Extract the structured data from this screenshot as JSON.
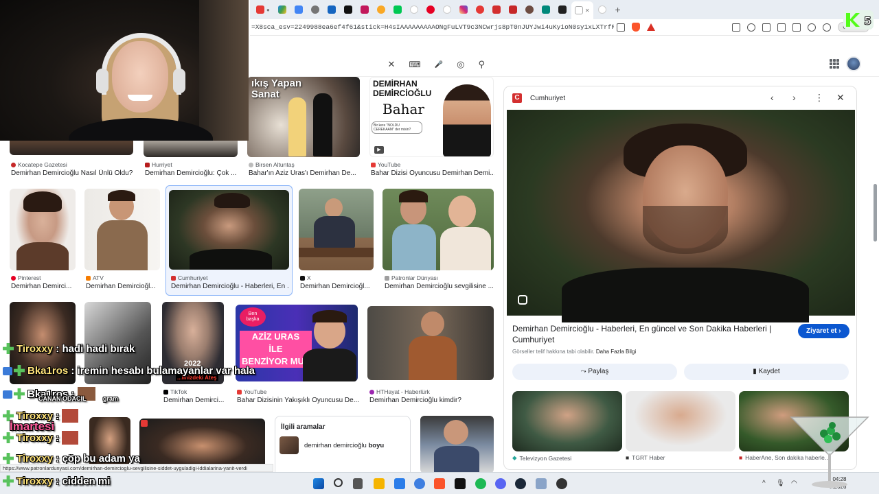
{
  "browser": {
    "url": "=X8sca_esv=2249988ea6ef4f61&stick=H4sIAAAAAAAAAONgFuLVT9c3NCwrjs8pT0nJUYJwi4uKyioN0sy1xLXTrfRLyoAovqAoP70...",
    "new_tab": "+",
    "profile_label": "Güncelle"
  },
  "search": {
    "clear_icon": "✕",
    "keyboard_icon": "⌨",
    "mic_icon": "🎤",
    "lens_icon": "◎",
    "search_icon": "⚲"
  },
  "results": [
    {
      "source": "Kocatepe Gazetesi",
      "caption": "Demirhan Demircioğlu Nasıl Ünlü Oldu?"
    },
    {
      "source": "Hurriyet",
      "caption": "Demirhan Demircioğlu: Çok ..."
    },
    {
      "source": "Birsen Altuntaş",
      "caption": "Bahar'ın Aziz Uras'ı Demirhan De..."
    },
    {
      "source": "YouTube",
      "caption": "Bahar Dizisi Oyuncusu Demirhan Demi..."
    },
    {
      "source": "Pinterest",
      "caption": "Demirhan Demirci..."
    },
    {
      "source": "ATV",
      "caption": "Demirhan Demircioğl..."
    },
    {
      "source": "Cumhuriyet",
      "caption": "Demirhan Demircioğlu - Haberleri, En ..."
    },
    {
      "source": "X",
      "caption": "Demirhan Demircioğl..."
    },
    {
      "source": "Patronlar Dünyası",
      "caption": "Demirhan Demircioğlu sevgilisine ..."
    },
    {
      "source": "TikTok",
      "caption": "Demirhan Demirci..."
    },
    {
      "source": "YouTube",
      "caption": "Bahar Dizisinin Yakışıklı Oyuncusu De..."
    },
    {
      "source": "HTHayat - Haberlürk",
      "caption": "Demirhan Demircioğlu kimdir?"
    }
  ],
  "thumb_texts": {
    "banner_text": "ıkış Yapan\nSanat",
    "demirhan_title": "DEMİRHAN\nDEMİRCİOĞLU",
    "bahar": "Bahar",
    "bahar_sub": "Bir kere \"NOLDU CEREKAAM\" der misin?",
    "aziz_uras": "AZİZ URAS\nİLE\nBENZİYOR MU?",
    "ben_baska": "Ben\nbaşka",
    "year": "2022",
    "ates": "...imizdeki Ateş"
  },
  "related": {
    "header": "İlgili aramalar",
    "item_prefix": "demirhan demircioğlu",
    "item_bold": "boyu"
  },
  "panel": {
    "source": "Cumhuriyet",
    "title": "Demirhan Demircioğlu - Haberleri, En güncel ve Son Dakika Haberleri | Cumhuriyet",
    "visit": "Ziyaret et",
    "license_text": "Görseller telif hakkına tabi olabilir.",
    "license_link": "Daha Fazla Bilgi",
    "share": "Paylaş",
    "save": "Kaydet",
    "related_sources": [
      "Televizyon Gazetesi",
      "TGRT Haber",
      "HaberAne, Son dakika haberle..."
    ]
  },
  "chat": [
    {
      "user": "Tiroxxy",
      "sep": " : ",
      "text": "hadi hadi bırak"
    },
    {
      "user": "Bka1ros",
      "sep": " : ",
      "text": "iremin hesabı bulamayanlar var hala"
    },
    {
      "user": "Bka1ros",
      "sep": " : ",
      "text": ""
    },
    {
      "user": "Tiroxxy",
      "sep": " : ",
      "text": ""
    },
    {
      "user": "Tiroxxy",
      "sep": " : ",
      "text": ""
    },
    {
      "user": "Tiroxxy",
      "sep": " : ",
      "text": "çöp bu adam ya"
    },
    {
      "user": "Tiroxxy",
      "sep": " : ",
      "text": "cidden mi"
    }
  ],
  "chat_extra": {
    "martesi": "İmartesi",
    "canan": "CANAN ODACIL",
    "gram": "gram"
  },
  "sticker_number": "5",
  "statusbar": "https://www.patronlardunyasi.com/demirhan-demircioglu-sevgilisine-siddet-uyguladigi-iddialarina-yanit-verdi",
  "clock": {
    "time": "04:28",
    "date": "...2026"
  },
  "colors": {
    "accent": "#0b57d0",
    "chat_user": "#ffe37a",
    "cumhuriyet_red": "#d32f2f"
  }
}
